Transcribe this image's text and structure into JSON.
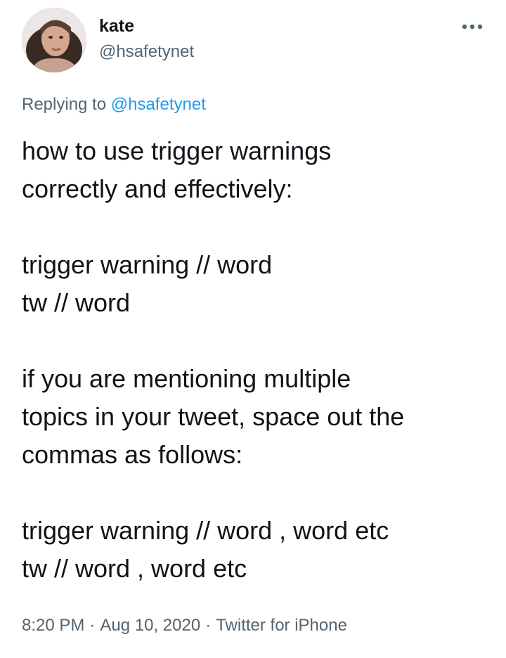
{
  "tweet": {
    "author": {
      "display_name": "kate",
      "handle": "@hsafetynet"
    },
    "more_icon": "more-horizontal-icon",
    "reply": {
      "prefix": "Replying to ",
      "mention": "@hsafetynet"
    },
    "body_lines": [
      "how to use trigger warnings",
      "correctly and effectively:",
      "",
      "trigger warning // word",
      "tw // word",
      "",
      "if you are mentioning multiple",
      "topics in your tweet, space out the",
      "commas as follows:",
      "",
      "trigger warning // word , word etc",
      "tw // word , word etc"
    ],
    "meta": {
      "time": "8:20 PM",
      "separator": "·",
      "date": "Aug 10, 2020",
      "source": "Twitter for iPhone"
    }
  },
  "colors": {
    "text": "#0f1419",
    "secondary": "#536471",
    "link": "#1d9bf0"
  }
}
